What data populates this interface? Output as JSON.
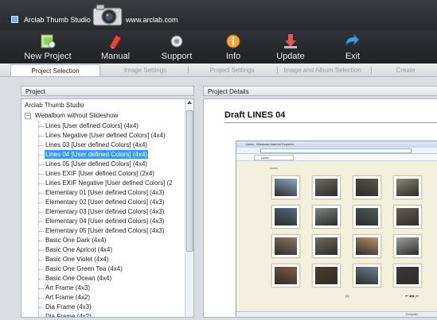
{
  "window": {
    "title": "Arclab Thumb Studio",
    "url_text": "www.arclab.com",
    "accent": "#3399ff"
  },
  "toolbar": {
    "buttons": [
      {
        "label": "New Project",
        "icon": "new-project-icon"
      },
      {
        "label": "Manual",
        "icon": "manual-icon"
      },
      {
        "label": "Support",
        "icon": "support-icon"
      },
      {
        "label": "Info",
        "icon": "info-icon"
      },
      {
        "label": "Update",
        "icon": "update-icon"
      },
      {
        "label": "Exit",
        "icon": "exit-icon"
      }
    ]
  },
  "tabs": [
    {
      "label": "Project Selection",
      "active": true
    },
    {
      "label": "Image Settings",
      "active": false
    },
    {
      "label": "Project Settings",
      "active": false
    },
    {
      "label": "Image and Album Selection",
      "active": false
    },
    {
      "label": "Create",
      "active": false
    }
  ],
  "project_panel": {
    "header": "Project",
    "root": "Arclab Thumb Studio",
    "group": "Webalbum without Slideshow",
    "group_expander": "−",
    "selected_index": 3,
    "items": [
      "Lines [User defined Colors] (4x4)",
      "Lines Negative [User defined Colors] (4x4)",
      "Lines 03 [User defined Colors] (4x4)",
      "Lines 04 [User defined Colors] (4x4)",
      "Lines 05 [User defined Colors] (4x4)",
      "Lines EXIF [User defined Colors] (2x4)",
      "Lines EXIF Negative [User defined Colors] (2",
      "Elementary 01 [User defined Colors] (4x3)",
      "Elementary 02 [User defined Colors] (4x3)",
      "Elementary 03 [User defined Colors] (4x3)",
      "Elementary 04 [User defined Colors] (4x3)",
      "Elementary 05 [User defined Colors] (4x3)",
      "Basic One Dark (4x4)",
      "Basic One Apricot (4x4)",
      "Basic One Violet (4x4)",
      "Basic One Green Tea (4x4)",
      "Basic One Ocean (4x4)",
      "Art Frame (4x3)",
      "Art Frame (4x2)",
      "Dia Frame (4x3)",
      "Dia Frame (4x2)"
    ]
  },
  "details_panel": {
    "header": "Project Details",
    "draft_title": "Draft LINES 04",
    "preview": {
      "window_title": "Lines - Windows Internet Explorer",
      "tab_label": "Lines",
      "page_heading": "Lines",
      "page_number": "(1)",
      "nav_controls": "⏮ ◀ ▶ ⏭",
      "status_text": "Computer",
      "photo_colors": [
        "#8fa7bf",
        "#6b6a60",
        "#59554a",
        "#8a8678",
        "#556a7c",
        "#7d8680",
        "#4f5a55",
        "#6a5c54",
        "#8b7766",
        "#6f6a5e",
        "#b8916a",
        "#9aa2a0",
        "#805b46",
        "#4a3e2a",
        "#6d7c8f",
        "#3b3a36"
      ]
    }
  }
}
